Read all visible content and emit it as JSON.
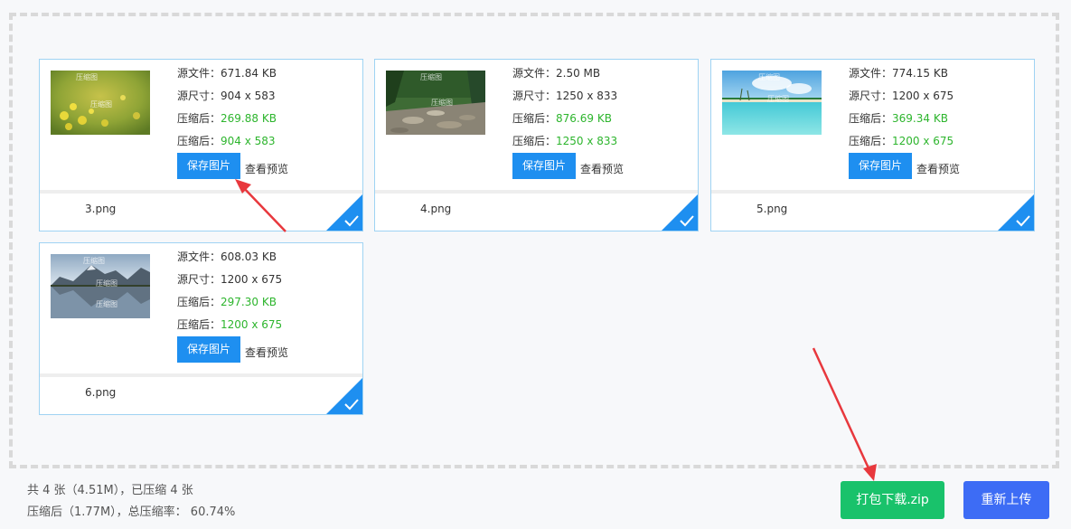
{
  "cards": [
    {
      "source_size_label": "源文件：",
      "source_size": "671.84 KB",
      "source_dim_label": "源尺寸：",
      "source_dim": "904 x 583",
      "compressed_size_label": "压缩后：",
      "compressed_size": "269.88 KB",
      "compressed_dim_label": "压缩后：",
      "compressed_dim": "904 x 583",
      "save_label": "保存图片",
      "preview_label": "查看预览",
      "filename": "3.png",
      "thumbnail": "yellow-flowers-photo",
      "watermark": "压缩图"
    },
    {
      "source_size_label": "源文件：",
      "source_size": "2.50 MB",
      "source_dim_label": "源尺寸：",
      "source_dim": "1250 x 833",
      "compressed_size_label": "压缩后：",
      "compressed_size": "876.69 KB",
      "compressed_dim_label": "压缩后：",
      "compressed_dim": "1250 x 833",
      "save_label": "保存图片",
      "preview_label": "查看预览",
      "filename": "4.png",
      "thumbnail": "forest-stream-photo",
      "watermark": "压缩图"
    },
    {
      "source_size_label": "源文件：",
      "source_size": "774.15 KB",
      "source_dim_label": "源尺寸：",
      "source_dim": "1200 x 675",
      "compressed_size_label": "压缩后：",
      "compressed_size": "369.34 KB",
      "compressed_dim_label": "压缩后：",
      "compressed_dim": "1200 x 675",
      "save_label": "保存图片",
      "preview_label": "查看预览",
      "filename": "5.png",
      "thumbnail": "tropical-beach-photo",
      "watermark": "压缩图"
    },
    {
      "source_size_label": "源文件：",
      "source_size": "608.03 KB",
      "source_dim_label": "源尺寸：",
      "source_dim": "1200 x 675",
      "compressed_size_label": "压缩后：",
      "compressed_size": "297.30 KB",
      "compressed_dim_label": "压缩后：",
      "compressed_dim": "1200 x 675",
      "save_label": "保存图片",
      "preview_label": "查看预览",
      "filename": "6.png",
      "thumbnail": "mountain-lake-photo",
      "watermark": "压缩图"
    }
  ],
  "footer": {
    "summary_line1": "共 4 张（4.51M），已压缩 4 张",
    "summary_line2": "压缩后（1.77M），总压缩率： 60.74%",
    "zip_label": "打包下载.zip",
    "reupload_label": "重新上传"
  },
  "colors": {
    "save_button": "#1e8ff0",
    "compressed_text": "#2db52d",
    "zip_button": "#19c26b",
    "reupload_button": "#3d6cf5",
    "card_border": "#9fd3f3",
    "check_corner": "#1e8ff0",
    "annotation_arrow": "#e8383d"
  }
}
